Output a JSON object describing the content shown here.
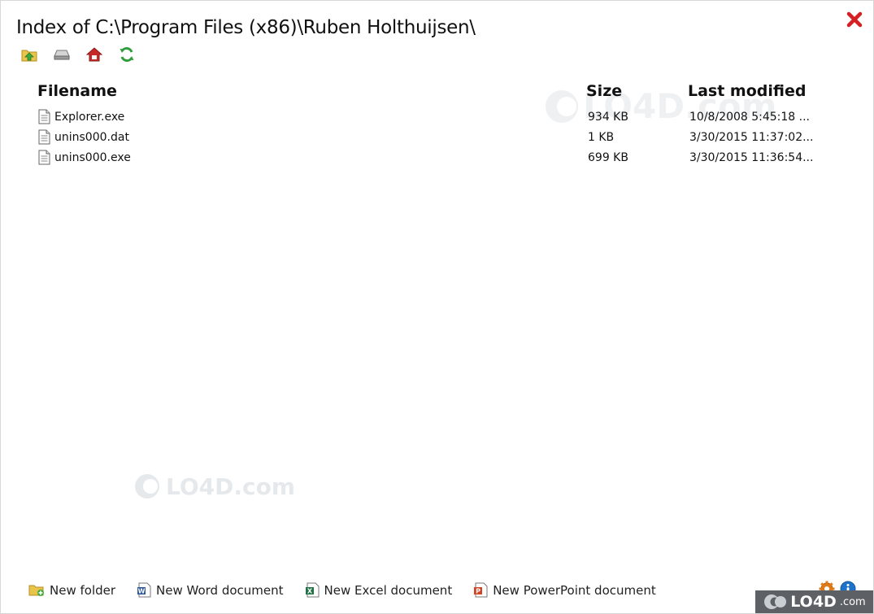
{
  "window": {
    "title": "Index of C:\\Program Files (x86)\\Ruben Holthuijsen\\"
  },
  "toolbar": {
    "icons": [
      "folder-up-icon",
      "drive-icon",
      "home-icon",
      "refresh-icon"
    ]
  },
  "list": {
    "headers": {
      "filename": "Filename",
      "size": "Size",
      "modified": "Last modified"
    },
    "rows": [
      {
        "name": "Explorer.exe",
        "size": "934 KB",
        "modified": "10/8/2008 5:45:18 ..."
      },
      {
        "name": "unins000.dat",
        "size": "1 KB",
        "modified": "3/30/2015 11:37:02..."
      },
      {
        "name": "unins000.exe",
        "size": "699 KB",
        "modified": "3/30/2015 11:36:54..."
      }
    ]
  },
  "bottom": {
    "new_folder": "New folder",
    "new_word": "New Word document",
    "new_excel": "New Excel document",
    "new_powerpoint": "New PowerPoint document"
  },
  "watermark": {
    "text": "LO4D.com",
    "badge_main": "LO4D",
    "badge_suffix": ".com"
  },
  "colors": {
    "close": "#d42020",
    "folder": "#e8c54a",
    "home": "#c62828",
    "refresh": "#2e9d3a",
    "word": "#2b579a",
    "excel": "#217346",
    "powerpoint": "#d04423",
    "info": "#1e73c8",
    "settings": "#e07b1a"
  }
}
